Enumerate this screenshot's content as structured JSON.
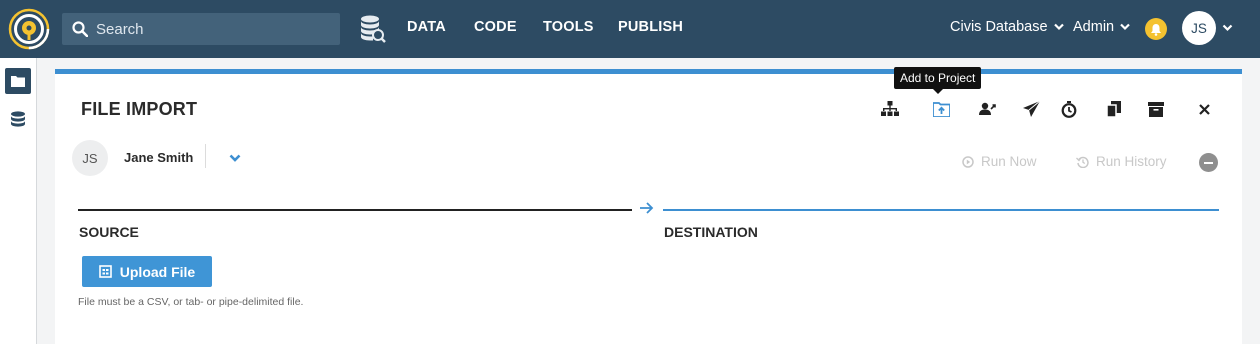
{
  "search": {
    "placeholder": "Search"
  },
  "nav": {
    "items": [
      "DATA",
      "CODE",
      "TOOLS",
      "PUBLISH"
    ]
  },
  "header_right": {
    "database": "Civis Database",
    "user_menu": "Admin",
    "avatar_initials": "JS"
  },
  "page": {
    "title": "FILE IMPORT",
    "tooltip": "Add to Project",
    "owner": {
      "initials": "JS",
      "name": "Jane Smith"
    },
    "run_now": "Run Now",
    "run_history": "Run History",
    "source_label": "SOURCE",
    "destination_label": "DESTINATION",
    "upload_button": "Upload File",
    "upload_hint": "File must be a CSV, or tab- or pipe-delimited file."
  },
  "toolbar_icons": [
    "org-chart-icon",
    "add-to-project-icon",
    "share-user-icon",
    "send-icon",
    "schedule-icon",
    "clone-icon",
    "archive-icon",
    "close-icon"
  ],
  "colors": {
    "nav_bg": "#2d4b63",
    "accent_blue": "#3d8fd1",
    "bell": "#f4c230"
  }
}
